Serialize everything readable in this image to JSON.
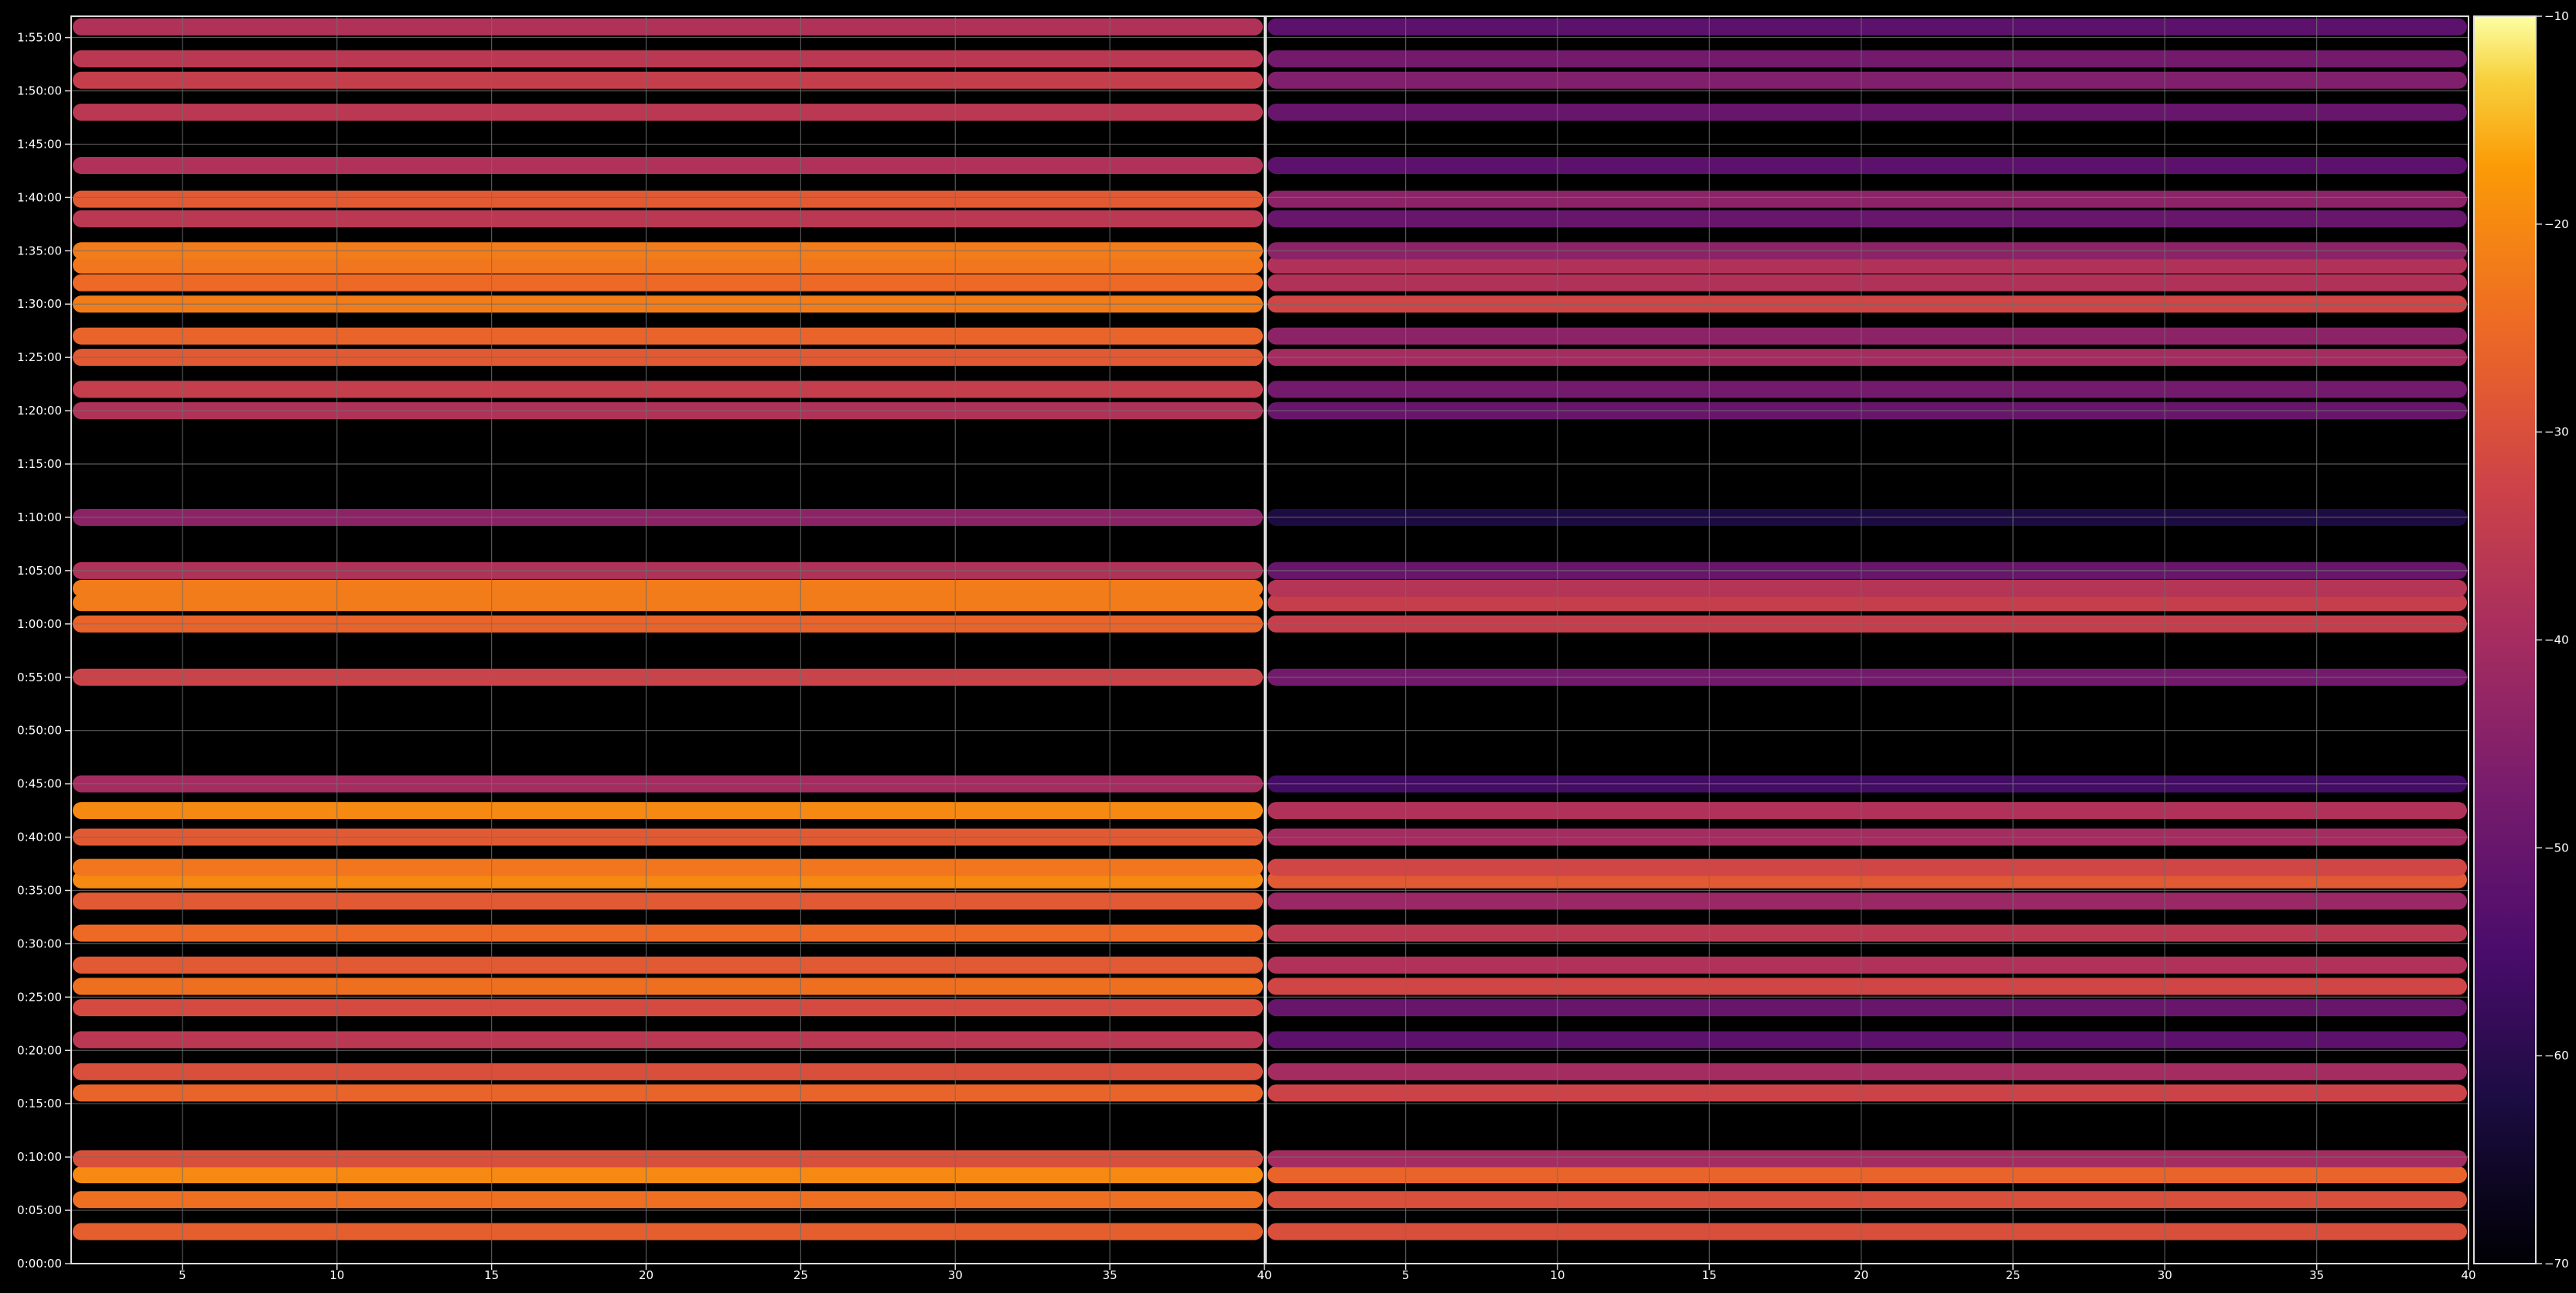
{
  "chart_data": {
    "type": "heatmap",
    "title": "",
    "xlabel": "",
    "ylabel": "",
    "grid": true,
    "colormap": "inferno",
    "background": "#000000",
    "grid_color": "#6e6e6e",
    "panels": [
      {
        "name": "left",
        "xlim": [
          1.4,
          40
        ],
        "xticks": [
          5,
          10,
          15,
          20,
          25,
          30,
          35,
          40
        ]
      },
      {
        "name": "right",
        "xlim": [
          0.4,
          40
        ],
        "xticks": [
          5,
          10,
          15,
          20,
          25,
          30,
          35,
          40
        ]
      }
    ],
    "yaxis": {
      "unit": "seconds",
      "ylim": [
        0,
        7020
      ],
      "tick_values": [
        0,
        300,
        600,
        900,
        1200,
        1500,
        1800,
        2100,
        2400,
        2700,
        3000,
        3300,
        3600,
        3900,
        4200,
        4500,
        4800,
        5100,
        5400,
        5700,
        6000,
        6300,
        6600,
        6900
      ],
      "tick_labels": [
        "0:00:00",
        "0:05:00",
        "0:10:00",
        "0:15:00",
        "0:20:00",
        "0:25:00",
        "0:30:00",
        "0:35:00",
        "0:40:00",
        "0:45:00",
        "0:50:00",
        "0:55:00",
        "1:00:00",
        "1:05:00",
        "1:10:00",
        "1:15:00",
        "1:20:00",
        "1:25:00",
        "1:30:00",
        "1:35:00",
        "1:40:00",
        "1:45:00",
        "1:50:00",
        "1:55:00"
      ]
    },
    "colorbar": {
      "range": [
        -70,
        -10
      ],
      "ticks": [
        -10,
        -20,
        -30,
        -40,
        -50,
        -60,
        -70
      ],
      "tick_labels": [
        "−10",
        "−20",
        "−30",
        "−40",
        "−50",
        "−60",
        "−70"
      ]
    },
    "bands": [
      {
        "name": "b0:03",
        "t": 180,
        "left": -27,
        "right": -30
      },
      {
        "name": "b0:06",
        "t": 360,
        "left": -24,
        "right": -30
      },
      {
        "name": "b0:08",
        "t": 500,
        "left": -20,
        "right": -26
      },
      {
        "name": "b0:10",
        "t": 590,
        "left": -30,
        "right": -40
      },
      {
        "name": "b0:16",
        "t": 960,
        "left": -26,
        "right": -33
      },
      {
        "name": "b0:18",
        "t": 1080,
        "left": -30,
        "right": -40
      },
      {
        "name": "b0:21",
        "t": 1260,
        "left": -36,
        "right": -52
      },
      {
        "name": "b0:24",
        "t": 1440,
        "left": -31,
        "right": -50
      },
      {
        "name": "b0:26",
        "t": 1560,
        "left": -24,
        "right": -32
      },
      {
        "name": "b0:28",
        "t": 1680,
        "left": -28,
        "right": -38
      },
      {
        "name": "b0:31",
        "t": 1860,
        "left": -25,
        "right": -36
      },
      {
        "name": "b0:34",
        "t": 2040,
        "left": -28,
        "right": -42
      },
      {
        "name": "b0:36",
        "t": 2160,
        "left": -20,
        "right": -28
      },
      {
        "name": "b0:37",
        "t": 2230,
        "left": -23,
        "right": -32
      },
      {
        "name": "b0:40",
        "t": 2400,
        "left": -28,
        "right": -40
      },
      {
        "name": "b0:42",
        "t": 2550,
        "left": -20,
        "right": -38
      },
      {
        "name": "b0:45",
        "t": 2700,
        "left": -40,
        "right": -56
      },
      {
        "name": "b0:55",
        "t": 3300,
        "left": -33,
        "right": -48
      },
      {
        "name": "b1:00",
        "t": 3600,
        "left": -26,
        "right": -34
      },
      {
        "name": "b1:02",
        "t": 3720,
        "left": -22,
        "right": -34
      },
      {
        "name": "b1:03",
        "t": 3800,
        "left": -22,
        "right": -37
      },
      {
        "name": "b1:05",
        "t": 3900,
        "left": -38,
        "right": -50
      },
      {
        "name": "b1:10",
        "t": 4200,
        "left": -44,
        "right": -62
      },
      {
        "name": "b1:20",
        "t": 4800,
        "left": -38,
        "right": -50
      },
      {
        "name": "b1:22",
        "t": 4920,
        "left": -34,
        "right": -48
      },
      {
        "name": "b1:25",
        "t": 5100,
        "left": -28,
        "right": -40
      },
      {
        "name": "b1:27",
        "t": 5220,
        "left": -26,
        "right": -44
      },
      {
        "name": "b1:30",
        "t": 5400,
        "left": -22,
        "right": -32
      },
      {
        "name": "b1:32",
        "t": 5520,
        "left": -25,
        "right": -38
      },
      {
        "name": "b1:34",
        "t": 5620,
        "left": -23,
        "right": -38
      },
      {
        "name": "b1:35",
        "t": 5700,
        "left": -22,
        "right": -44
      },
      {
        "name": "b1:38",
        "t": 5880,
        "left": -36,
        "right": -50
      },
      {
        "name": "b1:40",
        "t": 5990,
        "left": -28,
        "right": -44
      },
      {
        "name": "b1:43",
        "t": 6180,
        "left": -38,
        "right": -52
      },
      {
        "name": "b1:48",
        "t": 6480,
        "left": -36,
        "right": -50
      },
      {
        "name": "b1:51",
        "t": 6660,
        "left": -34,
        "right": -46
      },
      {
        "name": "b1:53",
        "t": 6780,
        "left": -36,
        "right": -48
      },
      {
        "name": "b1:56",
        "t": 6960,
        "left": -38,
        "right": -52
      }
    ]
  }
}
